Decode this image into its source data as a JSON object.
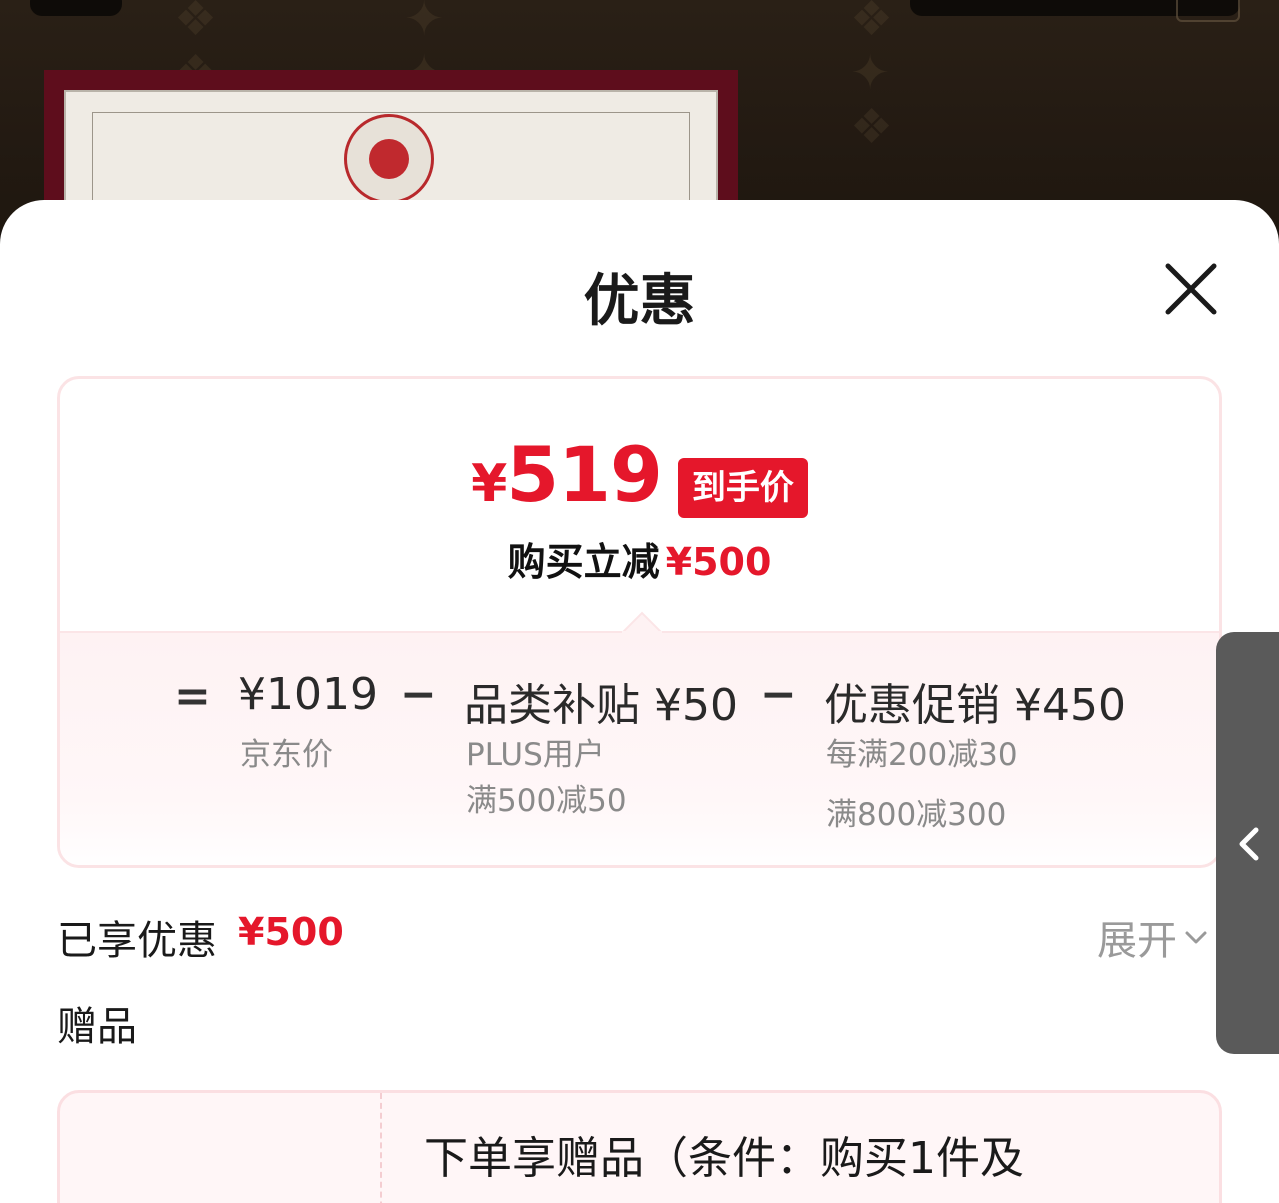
{
  "sheet": {
    "title": "优惠"
  },
  "summary": {
    "final_price_symbol": "¥",
    "final_price_value": "519",
    "final_price_tag": "到手价",
    "discount_label": "购买立减",
    "discount_amount": "¥500",
    "breakdown": {
      "equals_sign": "=",
      "minus_sign": "−",
      "jd_price": {
        "main": "¥1019",
        "label": "京东价"
      },
      "category_subsidy": {
        "main": "品类补贴 ¥50",
        "lines": [
          "PLUS用户",
          "满500减50"
        ]
      },
      "promotion": {
        "main": "优惠促销 ¥450",
        "lines": [
          "每满200减30",
          "满800减300"
        ]
      }
    }
  },
  "applied": {
    "label": "已享优惠",
    "amount": "¥500",
    "expand_label": "展开"
  },
  "gift": {
    "label": "赠品",
    "text": "下单享赠品（条件：购买1件及"
  },
  "colors": {
    "accent_red": "#e5172b",
    "card_border": "#fbe3e5",
    "side_tab": "#5a5a5a"
  },
  "icons": {
    "close": "close-icon",
    "expand": "chevron-down-icon",
    "side_tab": "chevron-left-icon"
  }
}
